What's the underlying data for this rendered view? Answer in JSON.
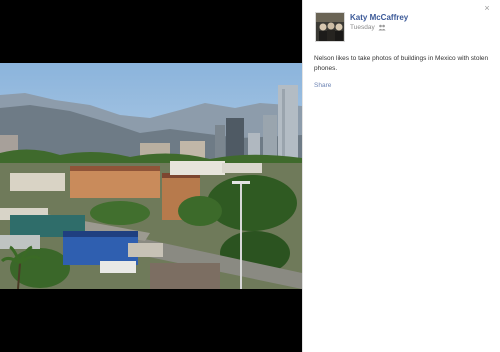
{
  "post": {
    "author": "Katy McCaffrey",
    "timestamp": "Tuesday",
    "privacy_icon": "friends-icon",
    "caption": "Nelson likes to take photos of buildings in Mexico with stolen phones.",
    "share_label": "Share"
  },
  "close_label": "×",
  "colors": {
    "viewer_background": "#000000",
    "link": "#3b5998",
    "share_link": "#6d84b4",
    "text": "#333333",
    "muted": "#8a8a8a"
  }
}
